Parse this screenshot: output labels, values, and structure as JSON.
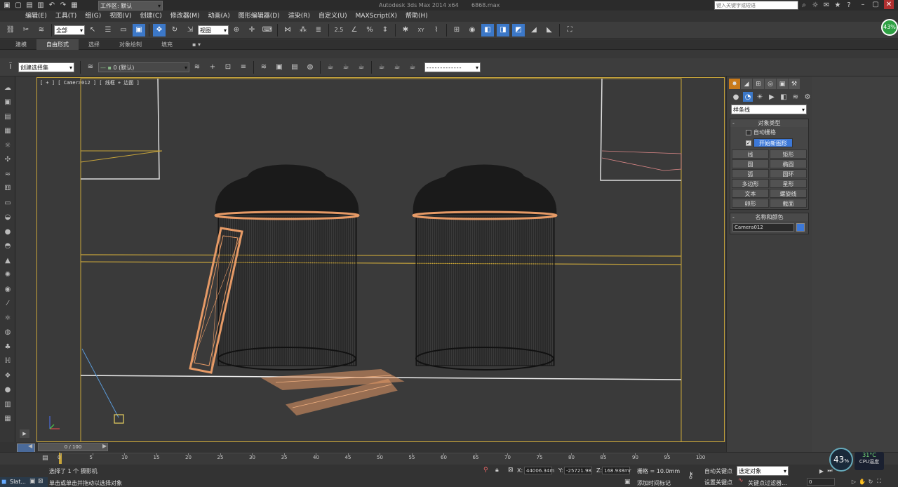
{
  "titlebar": {
    "workspace": "工作区: 默认",
    "app_title": "Autodesk 3ds Max  2014 x64",
    "file_name": "6868.max",
    "search_placeholder": "键入关键字或短语"
  },
  "menus": [
    "编辑(E)",
    "工具(T)",
    "组(G)",
    "视图(V)",
    "创建(C)",
    "修改器(M)",
    "动画(A)",
    "图形编辑器(D)",
    "渲染(R)",
    "自定义(U)",
    "MAXScript(X)",
    "帮助(H)"
  ],
  "toolbar": {
    "selection_filter": "全部",
    "ref_coord": "视图",
    "snap_label": "2.5",
    "percent_label": "%",
    "spinner_label": "XY"
  },
  "ribbon_tabs": [
    "建模",
    "自由形式",
    "选择",
    "对象绘制",
    "填充"
  ],
  "toolbar2": {
    "selection_set_placeholder": "创建选择集",
    "layer": "0 (默认)"
  },
  "viewport": {
    "label": "[ + ] [ Camera012 ] [ 线框 + 边面 ]"
  },
  "command_panel": {
    "category": "样条线",
    "object_type_title": "对象类型",
    "auto_grid": "自动栅格",
    "start_new_shape": "开始新图形",
    "object_buttons": [
      "线",
      "矩形",
      "圆",
      "椭圆",
      "弧",
      "圆环",
      "多边形",
      "星形",
      "文本",
      "螺旋线",
      "卵形",
      "截面"
    ],
    "name_color_title": "名称和颜色",
    "object_name": "Camera012",
    "object_color": "#3c78d8"
  },
  "timeline": {
    "frame": "0 / 100",
    "ticks": [
      "0",
      "5",
      "10",
      "15",
      "20",
      "25",
      "30",
      "35",
      "40",
      "45",
      "50",
      "55",
      "60",
      "65",
      "70",
      "75",
      "80",
      "85",
      "90",
      "95",
      "100"
    ]
  },
  "status": {
    "selection": "选择了 1 个 摄影机",
    "prompt": "单击或单击并拖动以选择对象",
    "taskbar_item": "Slat...",
    "x_label": "X:",
    "x": "44006.34m",
    "y_label": "Y:",
    "y": "-25721.98",
    "z_label": "Z:",
    "z": "168.938mr",
    "grid": "栅格 = 10.0mm",
    "add_time_tag": "添加时间标记",
    "auto_key": "自动关键点",
    "set_key": "设置关键点",
    "selected_object": "选定对象",
    "key_filters": "关键点过滤器...",
    "frame_field": "0"
  },
  "cpu": {
    "percent_top": "43%",
    "percent": "43",
    "percent_sign": "%",
    "temp": "31°C",
    "label": "CPU温度"
  }
}
